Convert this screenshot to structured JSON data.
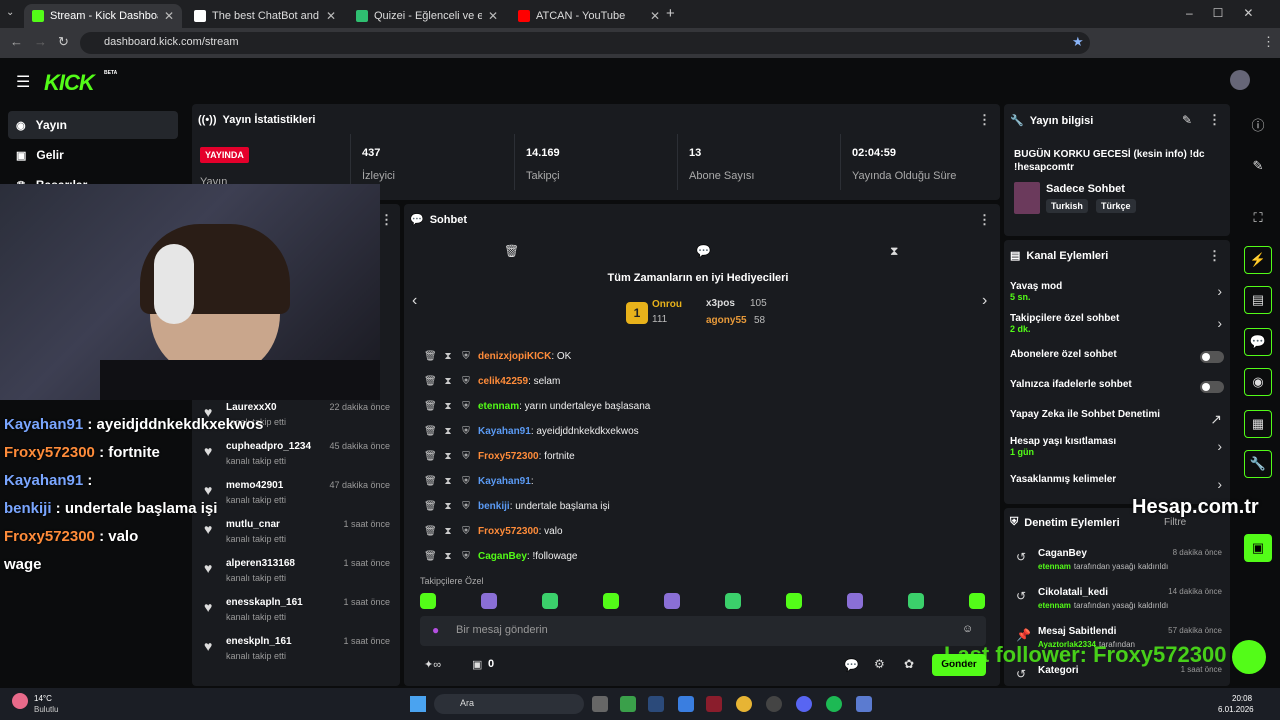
{
  "browser": {
    "tabs": [
      {
        "title": "Stream - Kick Dashboard",
        "color": "#53fc18"
      },
      {
        "title": "The best ChatBot and Widgets",
        "color": "#ffffff"
      },
      {
        "title": "Quizei - Eğlenceli ve etkileşimli",
        "color": "#2fbf71"
      },
      {
        "title": "ATCAN - YouTube",
        "color": "#ff0000"
      }
    ],
    "url": "dashboard.kick.com/stream"
  },
  "app": {
    "logo": "KICK",
    "logo_badge": "BETA",
    "sidebar": [
      {
        "label": "Yayın",
        "icon": "broadcast-icon"
      },
      {
        "label": "Gelir",
        "icon": "revenue-icon"
      },
      {
        "label": "Başarılar",
        "icon": "achievement-icon"
      }
    ]
  },
  "stats": {
    "title": "Yayın İstatistikleri",
    "live_badge": "YAYINDA",
    "live_label": "Yayın",
    "items": [
      {
        "value": "437",
        "label": "İzleyici"
      },
      {
        "value": "14.169",
        "label": "Takipçi"
      },
      {
        "value": "13",
        "label": "Abone Sayısı"
      },
      {
        "value": "02:04:59",
        "label": "Yayında Olduğu Süre"
      }
    ]
  },
  "chat": {
    "title": "Sohbet",
    "top_gifters_title": "Tüm Zamanların en iyi Hediyecileri",
    "gifters": [
      {
        "name": "Onrou",
        "amount": "111",
        "rank": "1"
      },
      {
        "name": "x3pos",
        "amount": "105"
      },
      {
        "name": "agony55",
        "amount": "58"
      }
    ],
    "messages": [
      {
        "user": "denizxjopiKICK",
        "color": "#ff8c3a",
        "text": ": OK"
      },
      {
        "user": "celik42259",
        "color": "#ff8c3a",
        "text": ": selam"
      },
      {
        "user": "etennam",
        "color": "#53fc18",
        "text": ": yarın undertaleye başlasana"
      },
      {
        "user": "Kayahan91",
        "color": "#5b9bf5",
        "text": ": ayeidjddnkekdkxekwos"
      },
      {
        "user": "Froxy572300",
        "color": "#ff8c3a",
        "text": ": fortnite"
      },
      {
        "user": "Kayahan91",
        "color": "#5b9bf5",
        "text": ":"
      },
      {
        "user": "benkiji",
        "color": "#5b9bf5",
        "text": ": undertale başlama işi"
      },
      {
        "user": "Froxy572300",
        "color": "#ff8c3a",
        "text": ": valo"
      },
      {
        "user": "CaganBey",
        "color": "#53fc18",
        "text": ": !followage"
      }
    ],
    "emote_bar_label": "Takipçilere Özel",
    "input_placeholder": "Bir mesaj gönderin",
    "points": "0",
    "send_label": "Gönder"
  },
  "followers": [
    {
      "name": "LaurexxX0",
      "sub": "kanalı takip etti",
      "time": "22 dakika önce"
    },
    {
      "name": "cupheadpro_1234",
      "sub": "kanalı takip etti",
      "time": "45 dakika önce"
    },
    {
      "name": "memo42901",
      "sub": "kanalı takip etti",
      "time": "47 dakika önce"
    },
    {
      "name": "mutlu_cnar",
      "sub": "kanalı takip etti",
      "time": "1 saat önce"
    },
    {
      "name": "alperen313168",
      "sub": "kanalı takip etti",
      "time": "1 saat önce"
    },
    {
      "name": "enesskapln_161",
      "sub": "kanalı takip etti",
      "time": "1 saat önce"
    },
    {
      "name": "eneskpln_161",
      "sub": "kanalı takip etti",
      "time": "1 saat önce"
    }
  ],
  "stream_info": {
    "title": "Yayın bilgisi",
    "stream_title": "BUGÜN KORKU GECESİ (kesin info) !dc !hesapcomtr",
    "category": "Sadece Sohbet",
    "tags": [
      "Turkish",
      "Türkçe"
    ]
  },
  "channel_actions": {
    "title": "Kanal Eylemleri",
    "items": [
      {
        "label": "Yavaş mod",
        "sub": "5 sn.",
        "kind": "arrow"
      },
      {
        "label": "Takipçilere özel sohbet",
        "sub": "2 dk.",
        "kind": "arrow"
      },
      {
        "label": "Abonelere özel sohbet",
        "sub": "",
        "kind": "toggle"
      },
      {
        "label": "Yalnızca ifadelerle sohbet",
        "sub": "",
        "kind": "toggle"
      },
      {
        "label": "Yapay Zeka ile Sohbet Denetimi",
        "sub": "",
        "kind": "external"
      },
      {
        "label": "Hesap yaşı kısıtlaması",
        "sub": "1 gün",
        "kind": "arrow"
      },
      {
        "label": "Yasaklanmış kelimeler",
        "sub": "",
        "kind": "arrow"
      }
    ]
  },
  "moderation": {
    "title": "Denetim Eylemleri",
    "filter": "Filtre",
    "items": [
      {
        "name": "CaganBey",
        "detail_user": "etennam",
        "detail": "tarafından yasağı kaldırıldı",
        "time": "8 dakika önce"
      },
      {
        "name": "Cikolatali_kedi",
        "detail_user": "etennam",
        "detail": "tarafından yasağı kaldırıldı",
        "time": "14 dakika önce"
      },
      {
        "name": "Mesaj Sabitlendi",
        "detail_user": "Ayaztorlak2334",
        "detail": "tarafından",
        "time": "57 dakika önce"
      },
      {
        "name": "Kategori",
        "detail_user": "",
        "detail": "",
        "time": "1 saat önce"
      }
    ]
  },
  "overlay": {
    "chat_lines": [
      {
        "user": "Kayahan91",
        "text": " : ayeidjddnkekdkxekwos",
        "color": "#7aa6ff"
      },
      {
        "user": "Froxy572300",
        "text": " : fortnite",
        "color": "#ff8c3a"
      },
      {
        "user": "Kayahan91",
        "text": " :",
        "color": "#7aa6ff"
      },
      {
        "user": "benkiji",
        "text": " : undertale başlama işi",
        "color": "#7aa6ff"
      },
      {
        "user": "Froxy572300",
        "text": " : valo",
        "color": "#ff8c3a"
      },
      {
        "user": "",
        "text": "wage",
        "color": "#ffffff"
      }
    ],
    "watermark": "Hesap.com.tr",
    "last_follower": "Last follower: Froxy572300"
  },
  "taskbar": {
    "weather_temp": "14°C",
    "weather_desc": "Bulutlu",
    "search": "Ara",
    "time": "20:08",
    "date": "6.01.2026"
  }
}
